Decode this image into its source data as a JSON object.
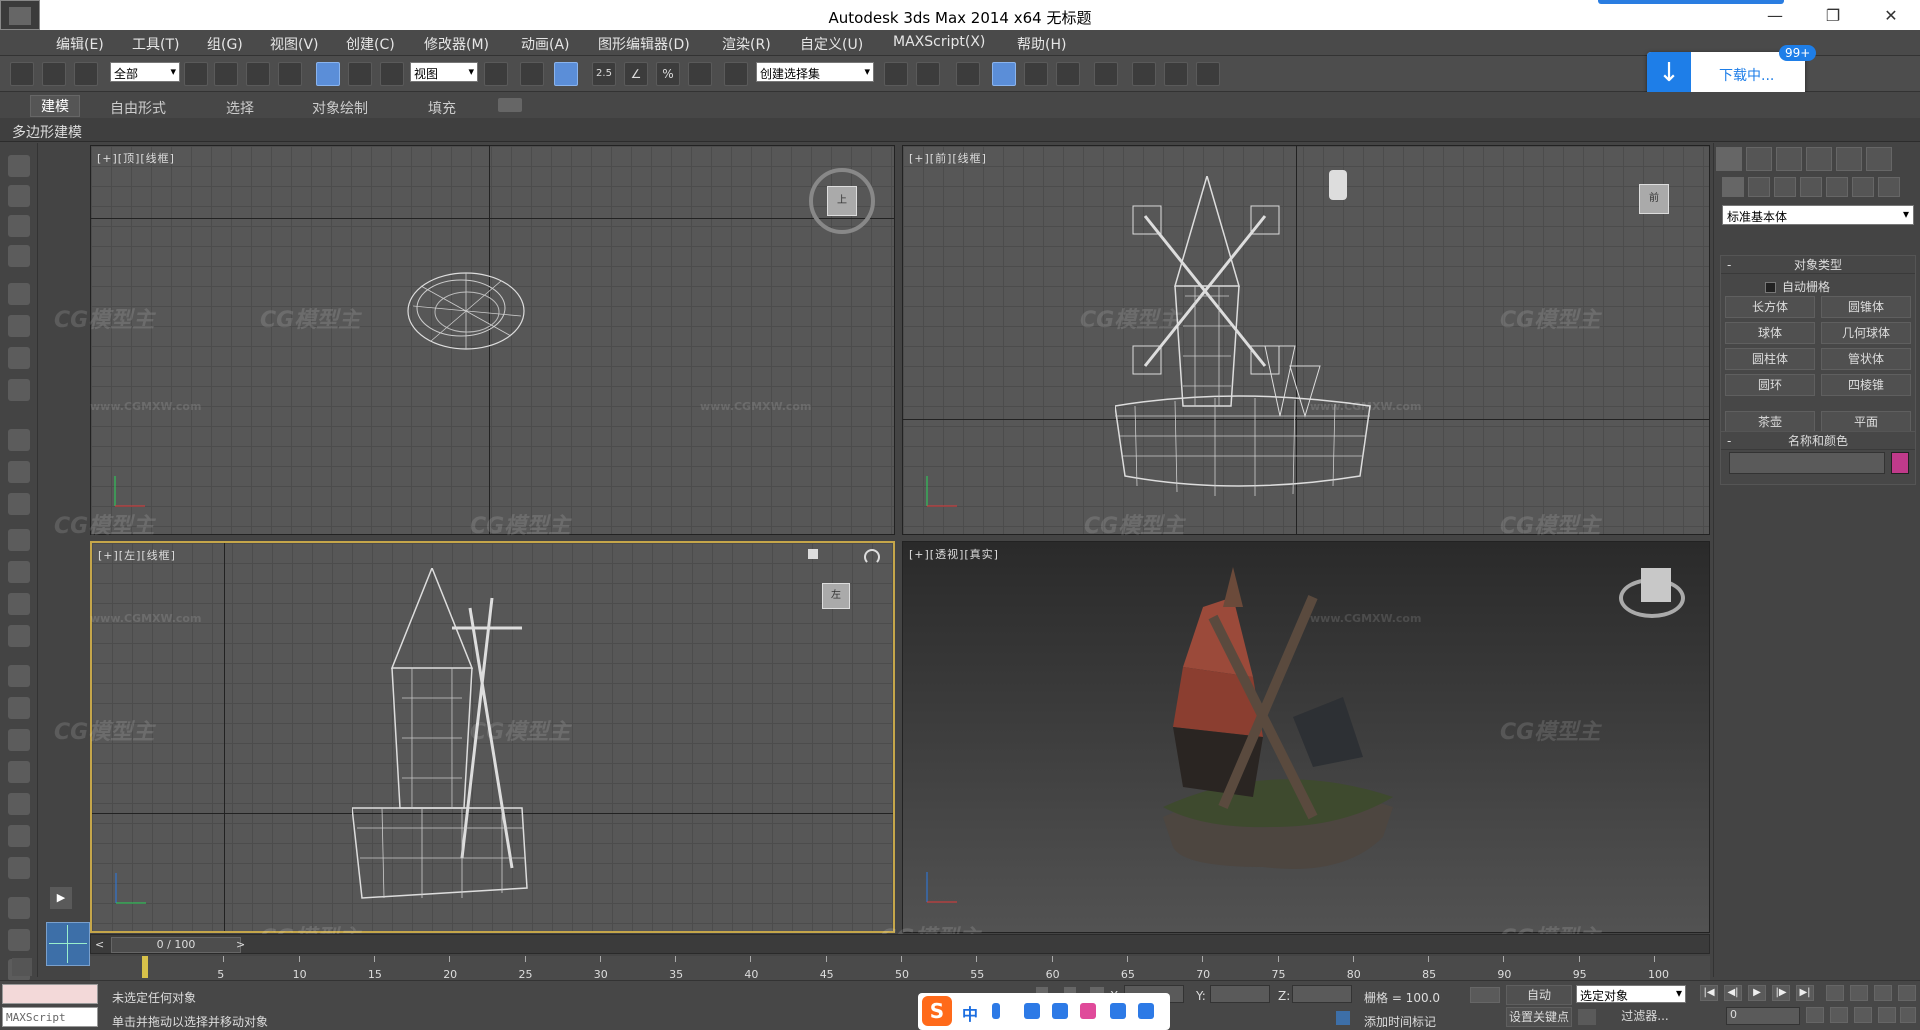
{
  "titlebar": {
    "title": "Autodesk 3ds Max  2014 x64      无标题",
    "minimize": "—",
    "restore": "❐",
    "close": "✕"
  },
  "menu": {
    "items": [
      "编辑(E)",
      "工具(T)",
      "组(G)",
      "视图(V)",
      "创建(C)",
      "修改器(M)",
      "动画(A)",
      "图形编辑器(D)",
      "渲染(R)",
      "自定义(U)",
      "MAXScript(X)",
      "帮助(H)"
    ]
  },
  "toolbar": {
    "filter_select": "全部",
    "ref_coord_select": "视图",
    "named_selection_select": "创建选择集",
    "snap_label": "2.5",
    "angle_label": "∠",
    "percent_label": "%"
  },
  "download": {
    "label": "下载中...",
    "badge": "99+",
    "arrow": "↓"
  },
  "ribbon": {
    "tabs": [
      "建模",
      "自由形式",
      "选择",
      "对象绘制",
      "填充"
    ],
    "sub_label": "多边形建模"
  },
  "viewports": {
    "top": {
      "label": "[+][顶][线框]",
      "cube": "上"
    },
    "front": {
      "label": "[+][前][线框]",
      "cube": "前"
    },
    "left": {
      "label": "[+][左][线框]",
      "cube": "左"
    },
    "persp": {
      "label": "[+][透视][真实]"
    }
  },
  "watermark": {
    "text": "CG模型主",
    "url": "www.CGMXW.com"
  },
  "command_panel": {
    "category_select": "标准基本体",
    "object_type_title": "对象类型",
    "autogrid_label": "自动栅格",
    "buttons": [
      "长方体",
      "圆锥体",
      "球体",
      "几何球体",
      "圆柱体",
      "管状体",
      "圆环",
      "四棱锥",
      "茶壶",
      "平面"
    ],
    "name_color_title": "名称和颜色",
    "swatch_color": "#c03a8a",
    "minus": "-"
  },
  "timeline": {
    "frame_readout": "0 / 100",
    "prev": "<",
    "next": ">",
    "ticks": [
      "5",
      "10",
      "15",
      "20",
      "25",
      "30",
      "35",
      "40",
      "45",
      "50",
      "55",
      "60",
      "65",
      "70",
      "75",
      "80",
      "85",
      "90",
      "95",
      "100"
    ]
  },
  "status": {
    "maxscript_label": "MAXScript",
    "line1": "未选定任何对象",
    "line2": "单击并拖动以选择并移动对象",
    "x_label": "X:",
    "y_label": "Y:",
    "z_label": "Z:",
    "grid_label": "栅格 = 100.0",
    "auto_label": "自动",
    "set_key_label": "设置关键点",
    "selection_select": "选定对象",
    "filter_label": "过滤器...",
    "add_time_tag": "添加时间标记",
    "frame_value": "0"
  },
  "ime": {
    "logo": "S",
    "mode": "中"
  }
}
